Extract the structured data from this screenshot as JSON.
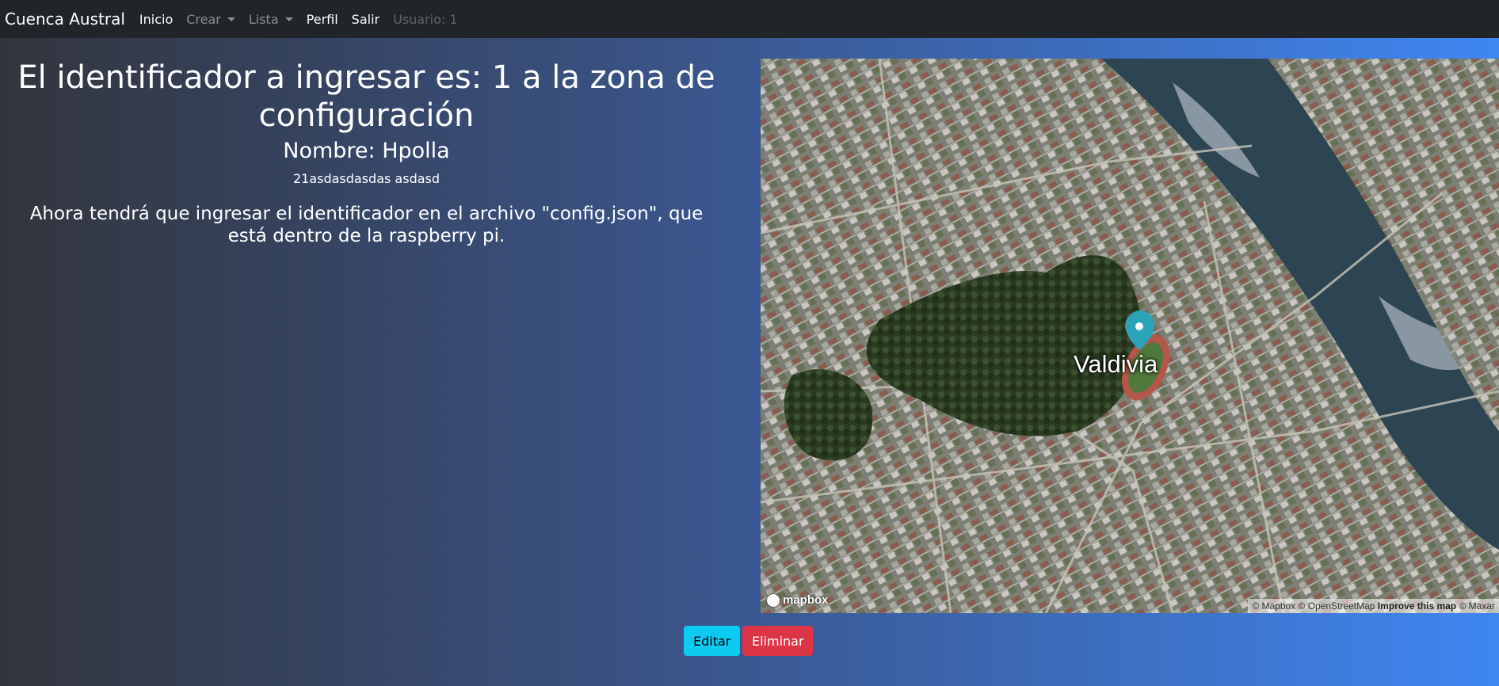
{
  "navbar": {
    "brand": "Cuenca Austral",
    "items": [
      {
        "label": "Inicio"
      },
      {
        "label": "Crear"
      },
      {
        "label": "Lista"
      },
      {
        "label": "Perfil"
      },
      {
        "label": "Salir"
      }
    ],
    "user": "Usuario: 1"
  },
  "main": {
    "title": "El identificador a ingresar es: 1 a la zona de configuración",
    "name": "Nombre: Hpolla",
    "description": "21asdasdasdas asdasd",
    "instructions": "Ahora tendrá que ingresar el identificador en el archivo \"config.json\", que está dentro de la raspberry pi."
  },
  "map": {
    "place_label": "Valdivia",
    "logo": "mapbox",
    "attribution": {
      "mapbox": "© Mapbox",
      "osm": "© OpenStreetMap",
      "improve": "Improve this map",
      "maxar": "© Maxar"
    },
    "marker_color": "#2ba3b8",
    "marker_icon": "map-pin-icon"
  },
  "actions": {
    "edit_label": "Editar",
    "delete_label": "Eliminar"
  },
  "colors": {
    "navbar_bg": "#212529",
    "edit_button": "#0dcaf0",
    "delete_button": "#dc3545"
  }
}
